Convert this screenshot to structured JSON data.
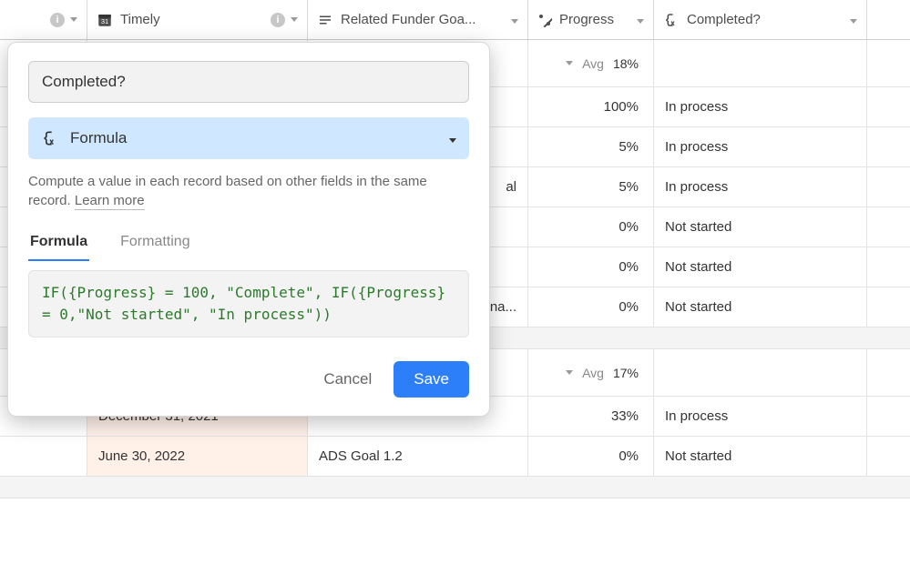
{
  "columns": {
    "timely": "Timely",
    "related": "Related Funder Goa...",
    "progress": "Progress",
    "completed": "Completed?"
  },
  "popover": {
    "field_name": "Completed?",
    "type_label": "Formula",
    "description": "Compute a value in each record based on other fields in the same record. ",
    "learn_more": "Learn more",
    "tabs": {
      "formula": "Formula",
      "formatting": "Formatting"
    },
    "formula_text": "IF({Progress} = 100, \"Complete\", IF({Progress} = 0,\"Not started\", \"In process\"))",
    "cancel": "Cancel",
    "save": "Save"
  },
  "group1": {
    "avg_label": "Avg",
    "avg_value": "18%",
    "rows": [
      {
        "related": "",
        "progress": "100%",
        "completed": "In process"
      },
      {
        "related": "",
        "progress": "5%",
        "completed": "In process"
      },
      {
        "related_suffix": "al",
        "progress": "5%",
        "completed": "In process"
      },
      {
        "related": "",
        "progress": "0%",
        "completed": "Not started"
      },
      {
        "related": "",
        "progress": "0%",
        "completed": "Not started"
      },
      {
        "related_suffix": "na...",
        "progress": "0%",
        "completed": "Not started"
      }
    ]
  },
  "group2": {
    "avg_label": "Avg",
    "avg_value": "17%",
    "rows": [
      {
        "timely": "December 31, 2021",
        "related": "",
        "progress": "33%",
        "completed": "In process"
      },
      {
        "timely": "June 30, 2022",
        "related": "ADS Goal 1.2",
        "progress": "0%",
        "completed": "Not started"
      }
    ]
  }
}
